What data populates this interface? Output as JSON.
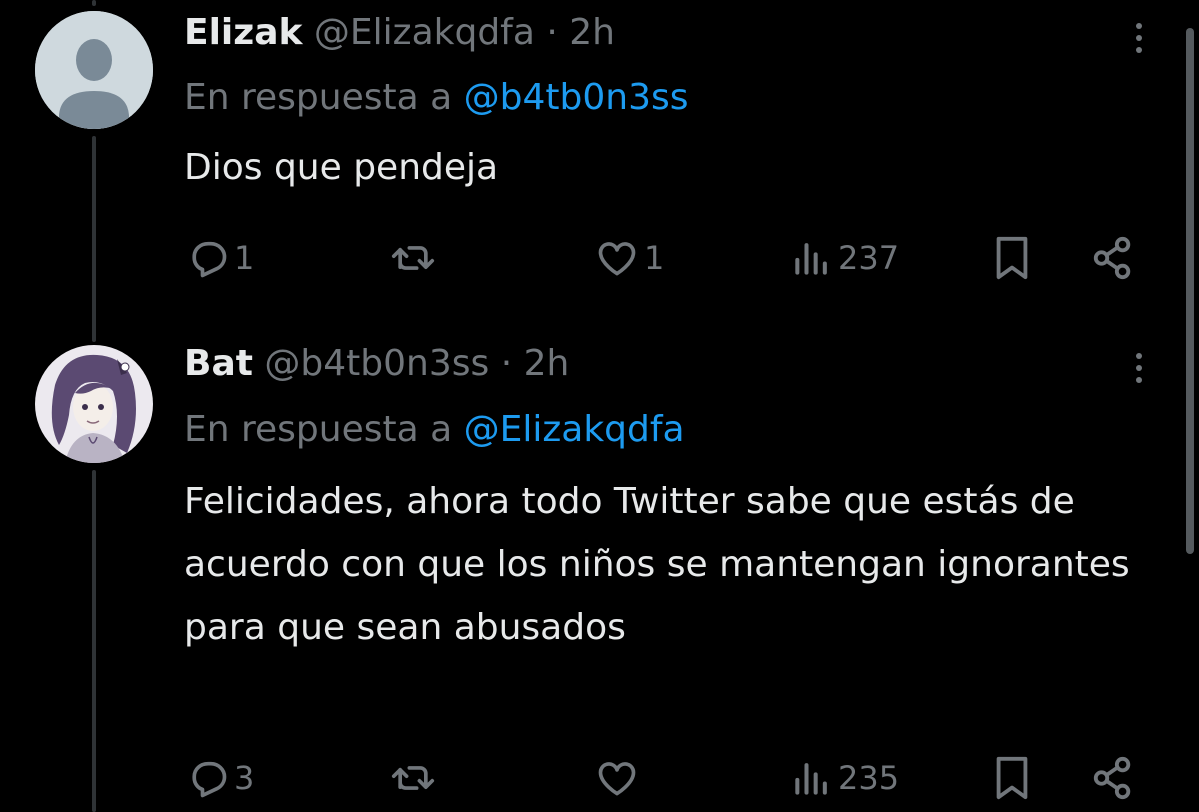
{
  "colors": {
    "background": "#000000",
    "text": "#e7e9ea",
    "muted": "#71767b",
    "mention": "#1d9bf0",
    "thread_line": "#2f3336"
  },
  "tweets": [
    {
      "name": "Elizak",
      "handle": "@Elizakqdfa",
      "separator": "·",
      "time": "2h",
      "reply_prefix": "En respuesta a",
      "reply_to": "@b4tb0n3ss",
      "text": "Dios que pendeja",
      "avatar": "default-avatar-icon",
      "actions": {
        "replies": "1",
        "retweets": "",
        "likes": "1",
        "views": "237"
      }
    },
    {
      "name": "Bat",
      "handle": "@b4tb0n3ss",
      "separator": "·",
      "time": "2h",
      "reply_prefix": "En respuesta a",
      "reply_to": "@Elizakqdfa",
      "text": "Felicidades, ahora todo Twitter sabe que estás de acuerdo con que los niños se mantengan ignorantes para que sean abusados",
      "avatar": "anime-girl-avatar",
      "actions": {
        "replies": "3",
        "retweets": "",
        "likes": "",
        "views": "235"
      }
    }
  ]
}
